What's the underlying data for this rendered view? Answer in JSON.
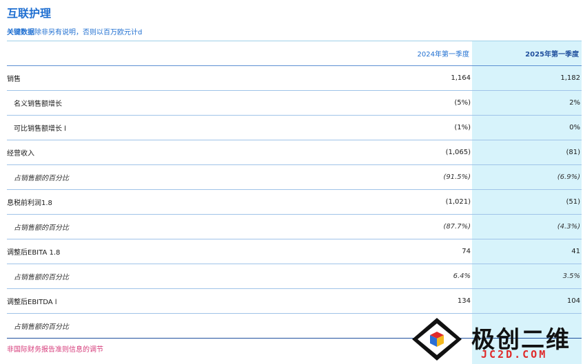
{
  "title": "互联护理",
  "subtitle": {
    "bold": "关键数据",
    "plain": "除非另有说明，否则以百万欧元计d"
  },
  "columns": [
    "2024年第一季度",
    "2025年第一季度"
  ],
  "rows": [
    {
      "label": "销售",
      "v2024": "1,164",
      "v2025": "1,182",
      "indent": false,
      "italic": false
    },
    {
      "label": "名义销售额增长",
      "v2024": "(5%)",
      "v2025": "2%",
      "indent": true,
      "italic": false
    },
    {
      "label": "可比销售额增长 l",
      "v2024": "(1%)",
      "v2025": "0%",
      "indent": true,
      "italic": false
    },
    {
      "label": "经营收入",
      "v2024": "(1,065)",
      "v2025": "(81)",
      "indent": false,
      "italic": false
    },
    {
      "label": "占销售额的百分比",
      "v2024": "(91.5%)",
      "v2025": "(6.9%)",
      "indent": true,
      "italic": true
    },
    {
      "label": "息税前利润1.8",
      "v2024": "(1,021)",
      "v2025": "(51)",
      "indent": false,
      "italic": false
    },
    {
      "label": "占销售额的百分比",
      "v2024": "(87.7%)",
      "v2025": "(4.3%)",
      "indent": true,
      "italic": true
    },
    {
      "label": "调整后EBITA 1.8",
      "v2024": "74",
      "v2025": "41",
      "indent": false,
      "italic": false
    },
    {
      "label": "占销售额的百分比",
      "v2024": "6.4%",
      "v2025": "3.5%",
      "indent": true,
      "italic": true
    },
    {
      "label": "调整后EBITDA l",
      "v2024": "134",
      "v2025": "104",
      "indent": false,
      "italic": false
    },
    {
      "label": "占销售额的百分比",
      "v2024": "",
      "v2025": "",
      "indent": true,
      "italic": true
    }
  ],
  "footnote": "非国际财务报告准则信息的调节",
  "watermark": {
    "brand": "极创二维",
    "url": "JC2D.COM"
  },
  "colors": {
    "title": "#1f6fd1",
    "highlight": "#d7f3fb",
    "footnote": "#d63b7a",
    "watermark_url": "#e02a2a"
  }
}
